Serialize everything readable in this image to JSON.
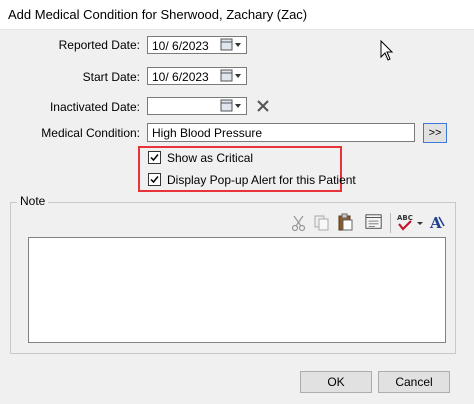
{
  "window": {
    "title": "Add Medical Condition for Sherwood, Zachary (Zac)"
  },
  "form": {
    "reported_label": "Reported Date:",
    "reported_value": "10/  6/2023",
    "start_label": "Start Date:",
    "start_value": "10/  6/2023",
    "inactivated_label": "Inactivated Date:",
    "inactivated_value": "",
    "condition_label": "Medical Condition:",
    "condition_value": "High Blood Pressure",
    "more_button": ">>"
  },
  "options": {
    "show_critical": {
      "label": "Show as Critical",
      "checked": true
    },
    "popup_alert": {
      "label": "Display Pop-up Alert for this Patient",
      "checked": true
    }
  },
  "note": {
    "label": "Note",
    "text": "",
    "toolbar": [
      "cut-icon",
      "copy-icon",
      "paste-icon",
      "template-icon",
      "spellcheck-icon",
      "font-icon"
    ]
  },
  "buttons": {
    "ok": "OK",
    "cancel": "Cancel"
  },
  "colors": {
    "highlight": "#e8333a",
    "accent": "#3c78d8"
  }
}
